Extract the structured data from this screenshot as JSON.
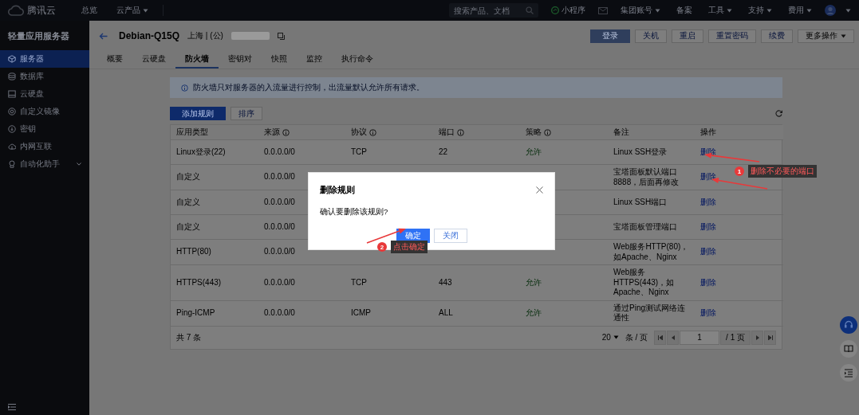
{
  "top_bar": {
    "logo_text": "腾讯云",
    "nav": [
      {
        "label": "总览",
        "dropdown": false
      },
      {
        "label": "云产品",
        "dropdown": true
      }
    ],
    "search": {
      "placeholder": "搜索产品、文档"
    },
    "links": [
      {
        "label": "小程序",
        "kind": "mini"
      },
      {
        "kind": "mail"
      },
      {
        "label": "集团账号",
        "kind": "dropdown"
      },
      {
        "label": "备案",
        "kind": "plain"
      },
      {
        "label": "工具",
        "kind": "dropdown"
      },
      {
        "label": "支持",
        "kind": "dropdown"
      },
      {
        "label": "费用",
        "kind": "dropdown"
      }
    ]
  },
  "sidebar": {
    "title": "轻量应用服务器",
    "items": [
      {
        "label": "服务器",
        "selected": true,
        "expandable": false
      },
      {
        "label": "数据库",
        "selected": false,
        "expandable": false
      },
      {
        "label": "云硬盘",
        "selected": false,
        "expandable": false
      },
      {
        "label": "自定义镜像",
        "selected": false,
        "expandable": false
      },
      {
        "label": "密钥",
        "selected": false,
        "expandable": false
      },
      {
        "label": "内网互联",
        "selected": false,
        "expandable": false
      },
      {
        "label": "自动化助手",
        "selected": false,
        "expandable": true
      }
    ]
  },
  "header": {
    "title": "Debian-Q15Q",
    "location": "上海 | (公)",
    "buttons": [
      {
        "label": "登录",
        "kind": "primary"
      },
      {
        "label": "关机",
        "kind": "default"
      },
      {
        "label": "重启",
        "kind": "default"
      },
      {
        "label": "重置密码",
        "kind": "default"
      },
      {
        "label": "续费",
        "kind": "default"
      },
      {
        "label": "更多操作",
        "kind": "dropdown"
      }
    ]
  },
  "tabs": [
    {
      "label": "概要",
      "selected": false
    },
    {
      "label": "云硬盘",
      "selected": false
    },
    {
      "label": "防火墙",
      "selected": true
    },
    {
      "label": "密钥对",
      "selected": false
    },
    {
      "label": "快照",
      "selected": false
    },
    {
      "label": "监控",
      "selected": false
    },
    {
      "label": "执行命令",
      "selected": false
    }
  ],
  "notice": "防火墙只对服务器的入流量进行控制，出流量默认允许所有请求。",
  "toolbar": [
    {
      "label": "添加规则",
      "kind": "primary"
    },
    {
      "label": "排序",
      "kind": "default"
    }
  ],
  "table": {
    "columns": [
      {
        "label": "应用类型",
        "info": false
      },
      {
        "label": "来源",
        "info": true
      },
      {
        "label": "协议",
        "info": true
      },
      {
        "label": "端口",
        "info": true
      },
      {
        "label": "策略",
        "info": true
      },
      {
        "label": "备注",
        "info": false
      },
      {
        "label": "操作",
        "info": false
      }
    ],
    "rows": [
      {
        "type": "Linux登录(22)",
        "source": "0.0.0.0/0",
        "protocol": "TCP",
        "port": "22",
        "policy": "允许",
        "remark": "Linux SSH登录",
        "action": "删除"
      },
      {
        "type": "自定义",
        "source": "0.0.0.0/0",
        "remark": "宝塔面板默认端口8888，后面再修改",
        "action": "删除"
      },
      {
        "type": "自定义",
        "source": "0.0.0.0/0",
        "remark": "Linux SSH端口",
        "action": "删除"
      },
      {
        "type": "自定义",
        "source": "0.0.0.0/0",
        "remark": "宝塔面板管理端口",
        "action": "删除"
      },
      {
        "type": "HTTP(80)",
        "source": "0.0.0.0/0",
        "remark": "Web服务HTTP(80)，如Apache、Nginx",
        "action": "删除"
      },
      {
        "type": "HTTPS(443)",
        "source": "0.0.0.0/0",
        "protocol": "TCP",
        "port": "443",
        "policy": "允许",
        "remark": "Web服务HTTPS(443)，如Apache、Nginx",
        "action": "删除"
      },
      {
        "type": "Ping-ICMP",
        "source": "0.0.0.0/0",
        "protocol": "ICMP",
        "port": "ALL",
        "policy": "允许",
        "remark": "通过Ping测试网络连通性",
        "action": "删除"
      }
    ],
    "footer": {
      "total": "共 7 条",
      "page_size": "20",
      "page_size_unit": "条 / 页",
      "page": "1",
      "page_total": "/ 1 页"
    }
  },
  "dialog": {
    "title": "删除规则",
    "message": "确认要删除该规则?",
    "buttons": [
      {
        "label": "确定",
        "kind": "primary"
      },
      {
        "label": "关闭",
        "kind": "default"
      }
    ]
  },
  "annotations": [
    {
      "number": "1",
      "text": "删除不必要的端口"
    },
    {
      "number": "2",
      "text": "点击确定"
    }
  ]
}
